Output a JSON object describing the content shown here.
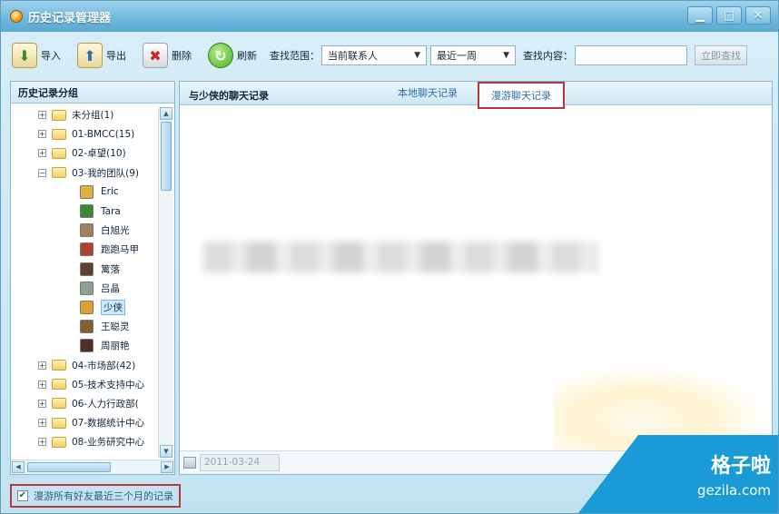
{
  "window": {
    "title": "历史记录管理器"
  },
  "toolbar": {
    "import_label": "导入",
    "export_label": "导出",
    "delete_label": "删除",
    "refresh_label": "刷新",
    "scope_label": "查找范围：",
    "scope_value": "当前联系人",
    "period_value": "最近一周",
    "content_label": "查找内容：",
    "content_value": "",
    "search_button": "立即查找"
  },
  "left_panel": {
    "header": "历史记录分组",
    "groups_top": [
      {
        "expander": "+",
        "label": "未分组(1)"
      },
      {
        "expander": "+",
        "label": "01-BMCC(15)"
      },
      {
        "expander": "+",
        "label": "02-卓望(10)"
      },
      {
        "expander": "−",
        "label": "03-我的团队(9)"
      }
    ],
    "contacts": [
      {
        "label": "Eric",
        "color": "#e0b040"
      },
      {
        "label": "Tara",
        "color": "#3a8a3a"
      },
      {
        "label": "白旭光",
        "color": "#a08060"
      },
      {
        "label": "跑跑马甲",
        "color": "#b04030"
      },
      {
        "label": "篱落",
        "color": "#604030"
      },
      {
        "label": "吕晶",
        "color": "#90a090"
      },
      {
        "label": "少侠",
        "color": "#e0a030",
        "selected": true
      },
      {
        "label": "王聪灵",
        "color": "#806030"
      },
      {
        "label": "周丽艳",
        "color": "#503020"
      }
    ],
    "groups_bottom": [
      {
        "expander": "+",
        "label": "04-市场部(42)"
      },
      {
        "expander": "+",
        "label": "05-技术支持中心"
      },
      {
        "expander": "+",
        "label": "06-人力行政部("
      },
      {
        "expander": "+",
        "label": "07-数据统计中心"
      },
      {
        "expander": "+",
        "label": "08-业务研究中心"
      }
    ]
  },
  "right_panel": {
    "title": "与少侠的聊天记录",
    "tab_local": "本地聊天记录",
    "tab_roam": "漫游聊天记录",
    "date_value": "2011-03-24"
  },
  "footer": {
    "roam_checkbox_label": "漫游所有好友最近三个月的记录",
    "checked": true
  },
  "watermark": {
    "cn": "格子啦",
    "en": "gezila.com"
  }
}
